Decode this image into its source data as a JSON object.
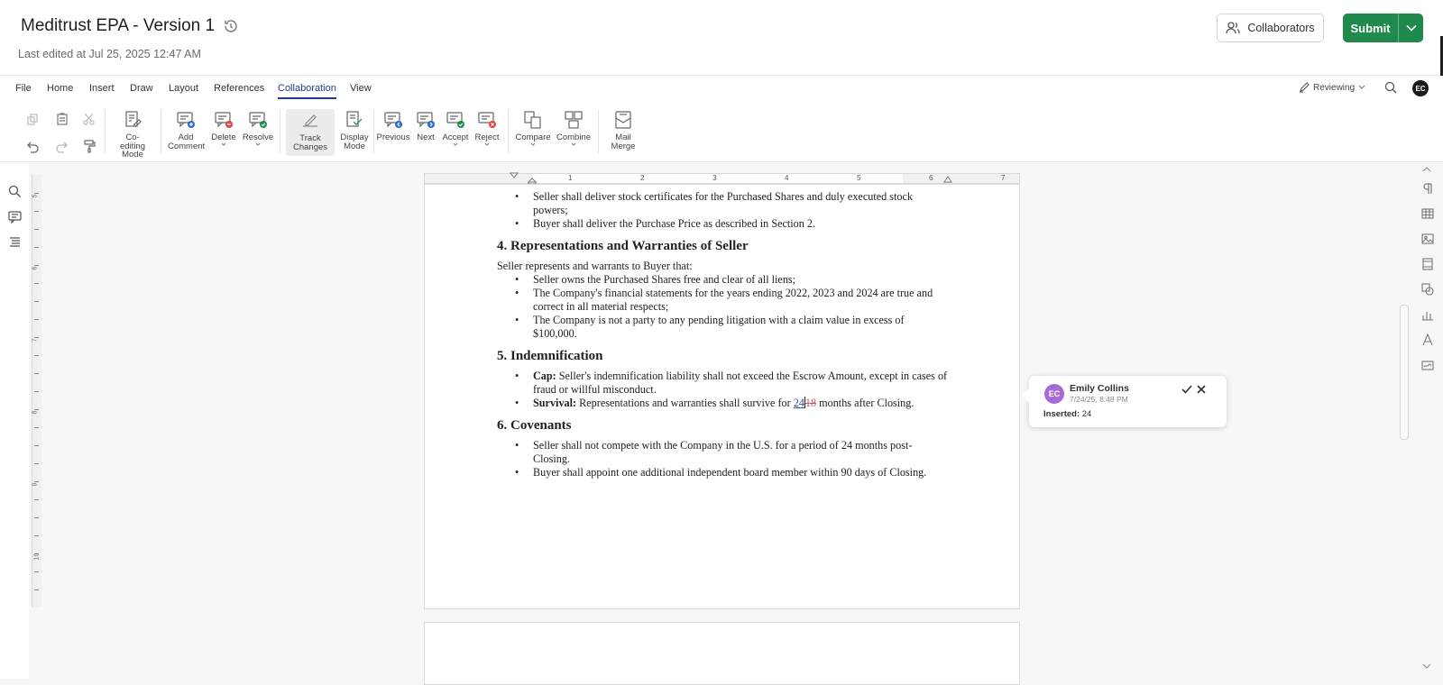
{
  "header": {
    "title": "Meditrust EPA - Version 1",
    "last_edited": "Last edited at Jul 25, 2025 12:47 AM",
    "collaborators_label": "Collaborators",
    "submit_label": "Submit"
  },
  "menu": {
    "items": [
      "File",
      "Home",
      "Insert",
      "Draw",
      "Layout",
      "References",
      "Collaboration",
      "View"
    ],
    "active": "Collaboration",
    "mode_label": "Reviewing",
    "avatar_initials": "EC"
  },
  "toolbar": {
    "coediting": "Co-editing Mode",
    "add_comment": "Add Comment",
    "delete": "Delete",
    "resolve": "Resolve",
    "track_changes": "Track Changes",
    "display_mode": "Display Mode",
    "previous": "Previous",
    "next": "Next",
    "accept": "Accept",
    "reject": "Reject",
    "compare": "Compare",
    "combine": "Combine",
    "mail_merge": "Mail Merge"
  },
  "document": {
    "bullets_top": [
      "Seller shall deliver stock certificates for the Purchased Shares and duly executed stock powers;",
      "Buyer shall deliver the Purchase Price as described in Section 2."
    ],
    "section4": {
      "heading": "4. Representations and Warranties of Seller",
      "intro": "Seller represents and warrants to Buyer that:",
      "bullets": [
        "Seller owns the Purchased Shares free and clear of all liens;",
        "The Company's financial statements for the years ending 2022, 2023 and 2024 are true and correct in all material respects;",
        "The Company is not a party to any pending litigation with a claim value in excess of $100,000."
      ]
    },
    "section5": {
      "heading": "5. Indemnification",
      "cap_label": "Cap:",
      "cap_text": " Seller's indemnification liability shall not exceed the Escrow Amount, except in cases of fraud or willful misconduct.",
      "survival_label": "Survival:",
      "survival_pre": " Representations and warranties shall survive for ",
      "survival_inserted": "24",
      "survival_deleted": "18",
      "survival_post": " months after Closing."
    },
    "section6": {
      "heading": "6. Covenants",
      "bullets": [
        "Seller shall not compete with the Company in the U.S. for a period of 24 months post-Closing.",
        "Buyer shall appoint one additional independent board member within 90 days of Closing."
      ]
    }
  },
  "comment": {
    "initials": "EC",
    "author": "Emily Collins",
    "date": "7/24/25, 8:48 PM",
    "label": "Inserted:",
    "value": "24"
  },
  "ruler": {
    "numbers": [
      "1",
      "2",
      "3",
      "4",
      "5",
      "6",
      "7"
    ],
    "vnumbers": [
      "5",
      "6",
      "7",
      "8",
      "9",
      "10"
    ]
  },
  "colors": {
    "submit": "#1f8a4c",
    "accent": "#1f3b8f",
    "inserted": "#2e4a9e",
    "deleted": "#c35a6b",
    "comment_avatar": "#a86bd6"
  }
}
